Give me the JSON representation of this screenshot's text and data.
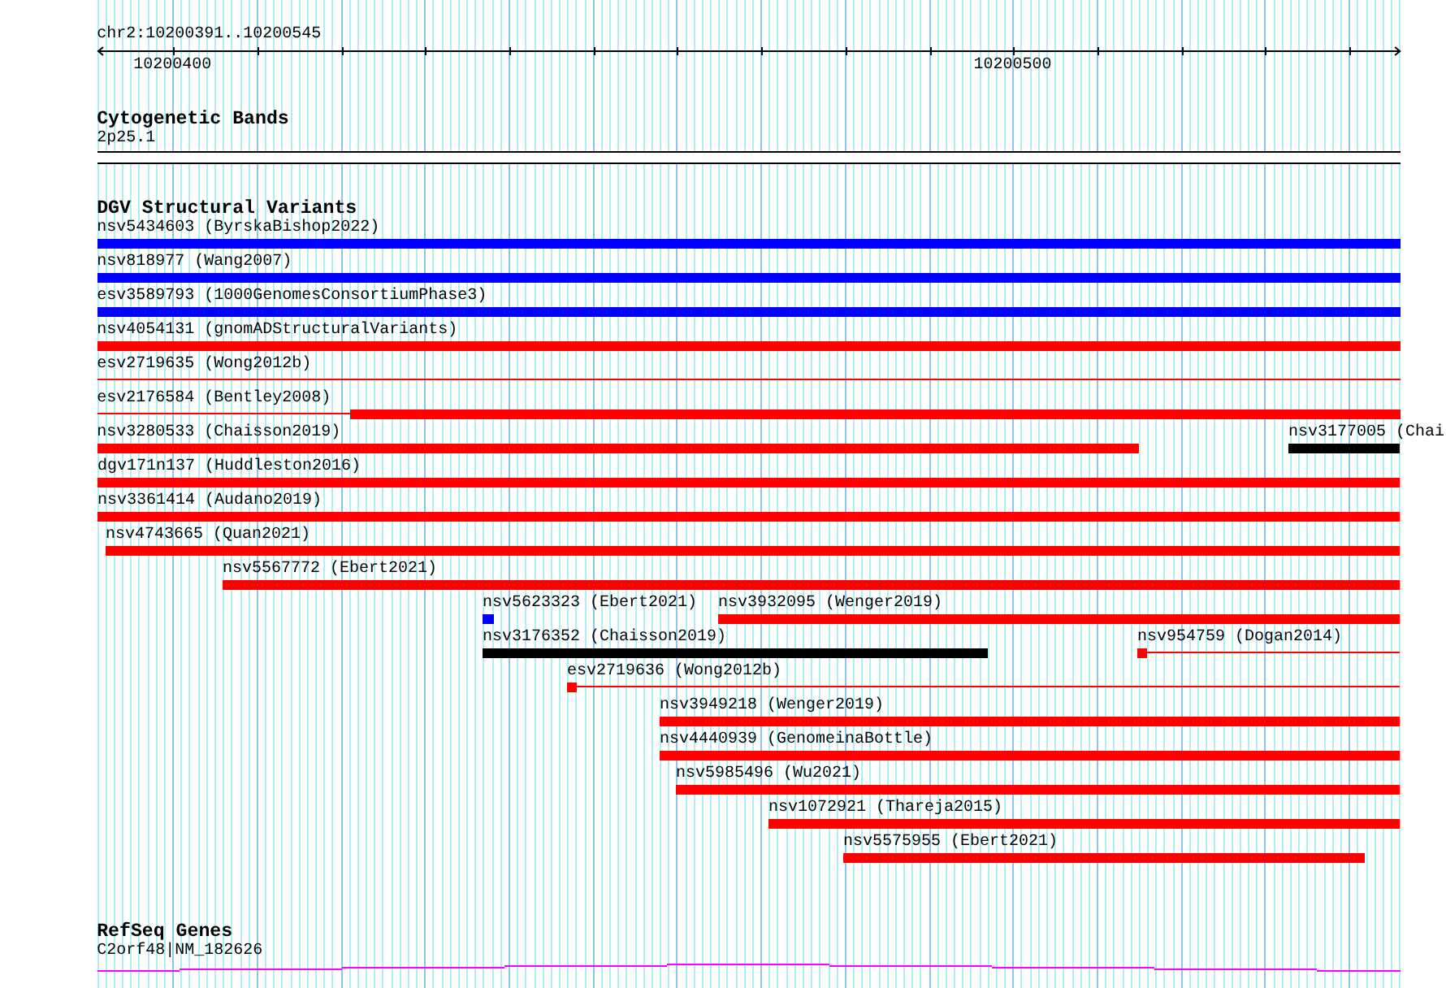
{
  "ruler": {
    "region": "chr2:10200391..10200545",
    "ticks": [
      "10200400",
      "10200500"
    ]
  },
  "tracks": [
    {
      "kind": "cytoband",
      "title": "Cytogenetic Bands",
      "features": [
        {
          "label": "2p25.1"
        }
      ]
    },
    {
      "kind": "variants",
      "title": "DGV Structural Variants",
      "rows": [
        {
          "features": [
            {
              "label": "nsv5434603 (ByrskaBishop2022)",
              "color": "#0000ff",
              "kind": "bar"
            }
          ]
        },
        {
          "features": [
            {
              "label": "nsv818977 (Wang2007)",
              "color": "#0000ff",
              "kind": "bar"
            }
          ]
        },
        {
          "features": [
            {
              "label": "esv3589793 (1000GenomesConsortiumPhase3)",
              "color": "#0000ff",
              "kind": "bar"
            }
          ]
        },
        {
          "features": [
            {
              "label": "nsv4054131 (gnomADStructuralVariants)",
              "color": "#ff0000",
              "kind": "bar"
            }
          ]
        },
        {
          "features": [
            {
              "label": "esv2719635 (Wong2012b)",
              "color": "#ff0000",
              "kind": "line"
            }
          ]
        },
        {
          "features": [
            {
              "label": "esv2176584 (Bentley2008)",
              "color": "#ff0000",
              "kind": "line-bar"
            }
          ]
        },
        {
          "features": [
            {
              "label": "nsv3280533 (Chaisson2019)",
              "color": "#ff0000",
              "kind": "bar"
            },
            {
              "label": "nsv3177005 (Chai",
              "color": "#000000",
              "kind": "bar"
            }
          ]
        },
        {
          "features": [
            {
              "label": "dgv171n137 (Huddleston2016)",
              "color": "#ff0000",
              "kind": "bar"
            }
          ]
        },
        {
          "features": [
            {
              "label": "nsv3361414 (Audano2019)",
              "color": "#ff0000",
              "kind": "bar"
            }
          ]
        },
        {
          "features": [
            {
              "label": "nsv4743665 (Quan2021)",
              "color": "#ff0000",
              "kind": "bar"
            }
          ]
        },
        {
          "features": [
            {
              "label": "nsv5567772 (Ebert2021)",
              "color": "#ff0000",
              "kind": "bar"
            }
          ]
        },
        {
          "features": [
            {
              "label": "nsv5623323 (Ebert2021)",
              "color": "#0000ff",
              "kind": "bar"
            },
            {
              "label": "nsv3932095 (Wenger2019)",
              "color": "#ff0000",
              "kind": "bar"
            }
          ]
        },
        {
          "features": [
            {
              "label": "nsv3176352 (Chaisson2019)",
              "color": "#000000",
              "kind": "bar"
            },
            {
              "label": "nsv954759 (Dogan2014)",
              "color": "#ff0000",
              "kind": "block-line"
            }
          ]
        },
        {
          "features": [
            {
              "label": "esv2719636 (Wong2012b)",
              "color": "#ff0000",
              "kind": "block-line"
            }
          ]
        },
        {
          "features": [
            {
              "label": "nsv3949218 (Wenger2019)",
              "color": "#ff0000",
              "kind": "bar"
            }
          ]
        },
        {
          "features": [
            {
              "label": "nsv4440939 (GenomeinaBottle)",
              "color": "#ff0000",
              "kind": "bar"
            }
          ]
        },
        {
          "features": [
            {
              "label": "nsv5985496 (Wu2021)",
              "color": "#ff0000",
              "kind": "bar"
            }
          ]
        },
        {
          "features": [
            {
              "label": "nsv1072921 (Thareja2015)",
              "color": "#ff0000",
              "kind": "bar"
            }
          ]
        },
        {
          "features": [
            {
              "label": "nsv5575955 (Ebert2021)",
              "color": "#ff0000",
              "kind": "bar"
            }
          ]
        }
      ]
    },
    {
      "kind": "gene",
      "title": "RefSeq Genes",
      "features": [
        {
          "label": "C2orf48|NM_182626"
        }
      ]
    }
  ]
}
